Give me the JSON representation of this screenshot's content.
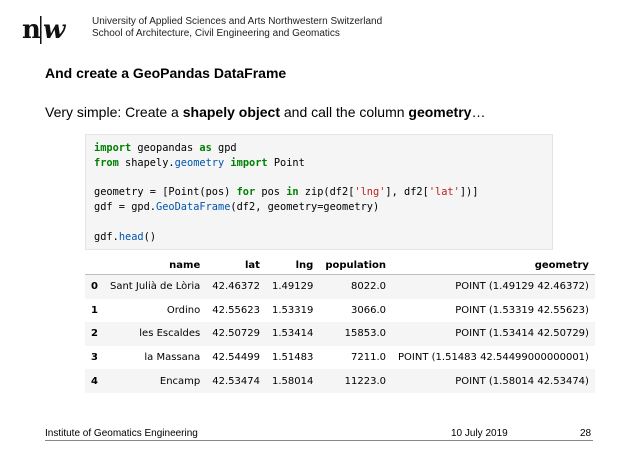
{
  "header": {
    "logo_text": "n|w",
    "institution_line1": "University of Applied Sciences and Arts Northwestern Switzerland",
    "institution_line2": "School of Architecture, Civil Engineering and Geomatics"
  },
  "slide": {
    "title": "And create a GeoPandas DataFrame",
    "subtitle_part1": "Very simple: Create a ",
    "subtitle_bold1": "shapely object",
    "subtitle_part2": " and call the column ",
    "subtitle_bold2": "geometry",
    "subtitle_part3": "…"
  },
  "code_lines": [
    "import geopandas as gpd",
    "from shapely.geometry import Point",
    "",
    "geometry = [Point(pos) for pos in zip(df2['lng'], df2['lat'])]",
    "gdf = gpd.GeoDataFrame(df2, geometry=geometry)",
    "",
    "gdf.head()"
  ],
  "table": {
    "columns": [
      "",
      "name",
      "lat",
      "lng",
      "population",
      "geometry"
    ],
    "rows": [
      [
        "0",
        "Sant Julià de Lòria",
        "42.46372",
        "1.49129",
        "8022.0",
        "POINT (1.49129 42.46372)"
      ],
      [
        "1",
        "Ordino",
        "42.55623",
        "1.53319",
        "3066.0",
        "POINT (1.53319 42.55623)"
      ],
      [
        "2",
        "les Escaldes",
        "42.50729",
        "1.53414",
        "15853.0",
        "POINT (1.53414 42.50729)"
      ],
      [
        "3",
        "la Massana",
        "42.54499",
        "1.51483",
        "7211.0",
        "POINT (1.51483 42.54499000000001)"
      ],
      [
        "4",
        "Encamp",
        "42.53474",
        "1.58014",
        "11223.0",
        "POINT (1.58014 42.53474)"
      ]
    ]
  },
  "footer": {
    "left": "Institute of Geomatics Engineering",
    "date": "10 July 2019",
    "page": "28"
  }
}
